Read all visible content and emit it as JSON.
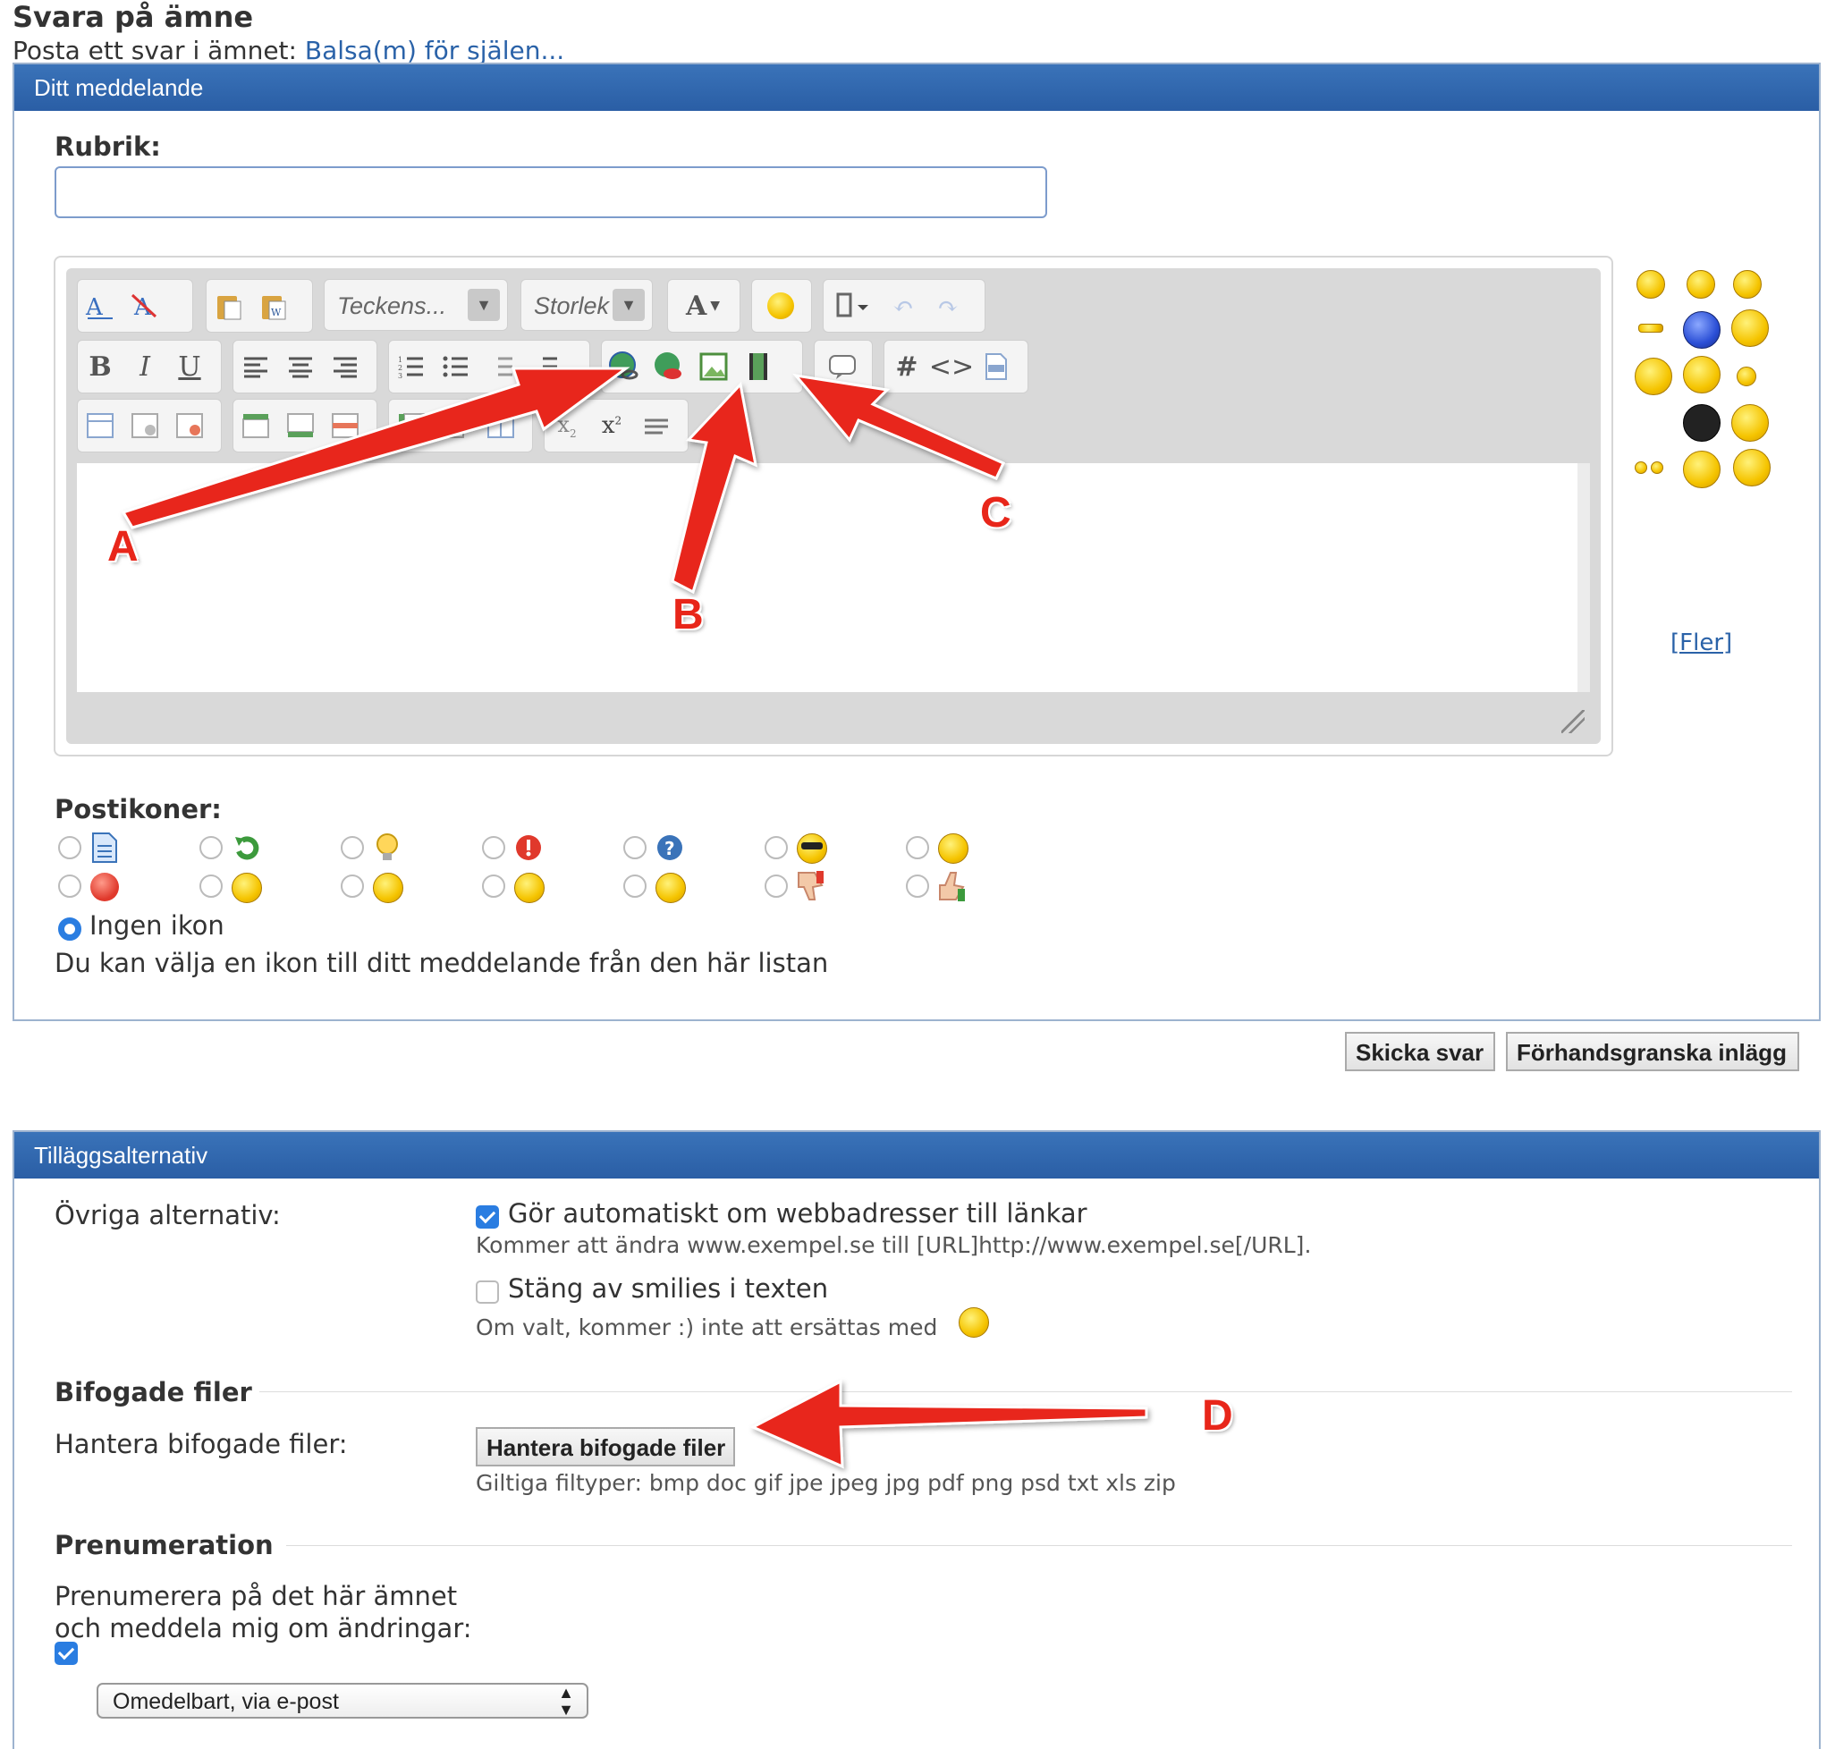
{
  "page": {
    "title": "Svara på ämne",
    "subtitle_prefix": "Posta ett svar i ämnet:",
    "topic_link": "Balsa(m) för själen..."
  },
  "message_section": {
    "header": "Ditt meddelande",
    "subject_label": "Rubrik:",
    "subject_value": "",
    "toolbar": {
      "font_combo": "Teckens...",
      "size_combo": "Storlek",
      "bold": "B",
      "italic": "I",
      "underline": "U",
      "hash": "#",
      "code": "<>",
      "font_color": "A"
    },
    "smilies_more": "[Fler]",
    "post_icons_label": "Postikoner:",
    "no_icon_label": "Ingen ikon",
    "post_icons_hint": "Du kan välja en ikon till ditt meddelande från den här listan"
  },
  "buttons": {
    "submit": "Skicka svar",
    "preview": "Förhandsgranska inlägg"
  },
  "options_section": {
    "header": "Tilläggsalternativ",
    "misc_label": "Övriga alternativ:",
    "auto_links_label": "Gör automatiskt om webbadresser till länkar",
    "auto_links_checked": true,
    "auto_links_hint": "Kommer att ändra www.exempel.se till [URL]http://www.exempel.se[/URL].",
    "disable_smilies_label": "Stäng av smilies i texten",
    "disable_smilies_checked": false,
    "disable_smilies_hint": "Om valt, kommer :) inte att ersättas med",
    "attachments_heading": "Bifogade filer",
    "attachments_label": "Hantera bifogade filer:",
    "attachments_button": "Hantera bifogade filer",
    "attachments_types": "Giltiga filtyper: bmp doc gif jpe jpeg jpg pdf png psd txt xls zip",
    "subscription_heading": "Prenumeration",
    "subscription_label_line1": "Prenumerera på det här ämnet",
    "subscription_label_line2": "och meddela mig om ändringar:",
    "subscription_checked": true,
    "subscription_select_value": "Omedelbart, via e-post"
  },
  "annotations": {
    "a": "A",
    "b": "B",
    "c": "C",
    "d": "D",
    "arrow_color": "#e8261a"
  },
  "colors": {
    "section_header": "#2f68b0",
    "link": "#2a62a8",
    "checkbox": "#2a7de1"
  }
}
